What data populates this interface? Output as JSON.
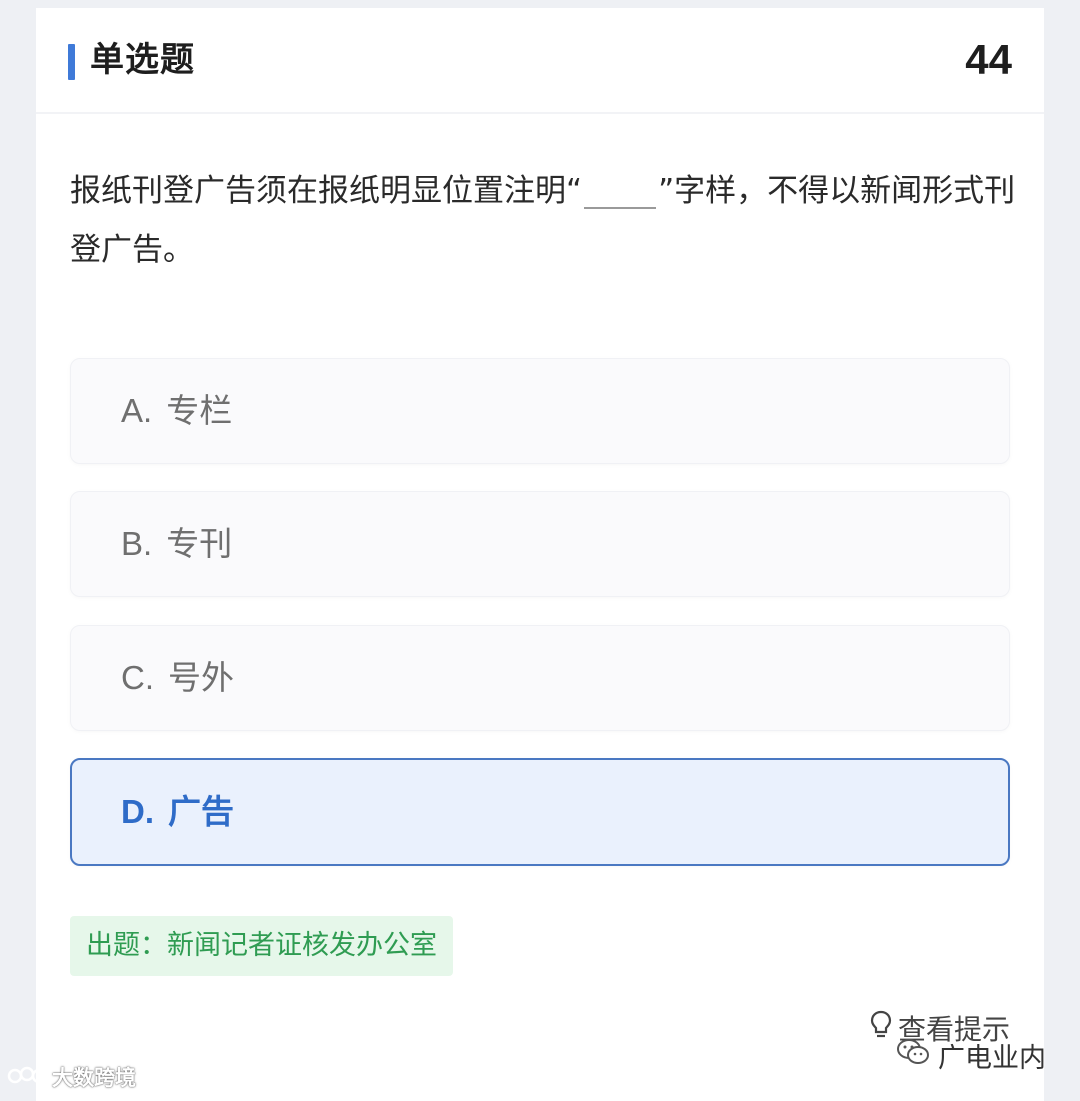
{
  "header": {
    "title": "单选题",
    "number": "44"
  },
  "question": {
    "text_before": "报纸刊登广告须在报纸明显位置注明“",
    "text_after": "”字样，不得以新闻形式刊登广告。"
  },
  "options": [
    {
      "letter": "A.",
      "label": "专栏",
      "selected": false
    },
    {
      "letter": "B.",
      "label": "专刊",
      "selected": false
    },
    {
      "letter": "C.",
      "label": "号外",
      "selected": false
    },
    {
      "letter": "D.",
      "label": "广告",
      "selected": true
    }
  ],
  "source": "出题：新闻记者证核发办公室",
  "hint": {
    "label": "查看提示",
    "icon": "lightbulb-icon"
  },
  "watermarks": {
    "left": "大数跨境",
    "right": "广电业内"
  },
  "colors": {
    "accent": "#3f7ad8",
    "selected_text": "#2f6cc8",
    "selected_bg": "#eaf1fd",
    "source_text": "#2f9c52",
    "source_bg": "#e6f7ea"
  }
}
